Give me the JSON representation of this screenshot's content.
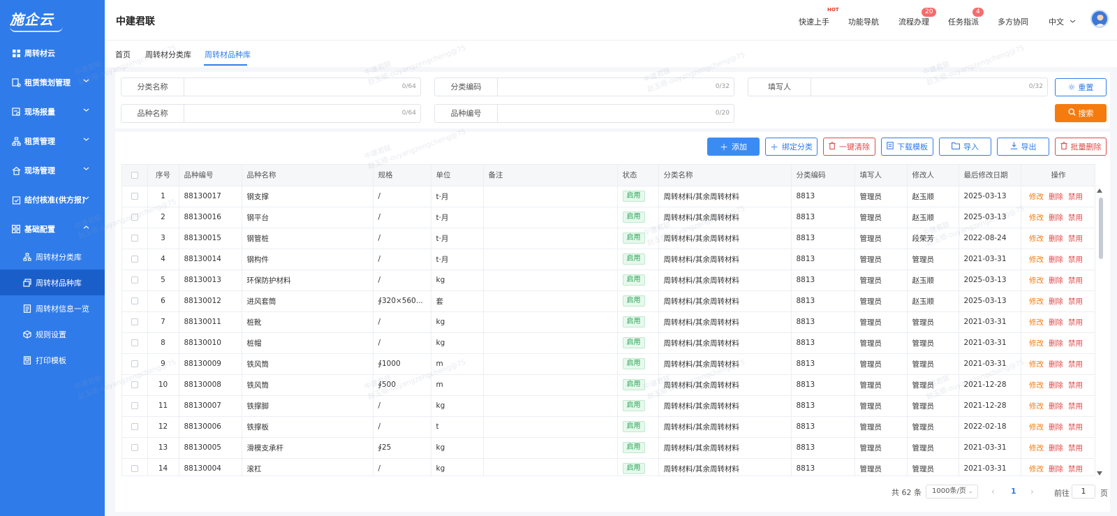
{
  "sidebar": {
    "logo": "施企云",
    "items": [
      {
        "label": "周转材云"
      },
      {
        "label": "租赁策划管理"
      },
      {
        "label": "现场报量"
      },
      {
        "label": "租赁管理"
      },
      {
        "label": "现场管理"
      },
      {
        "label": "结付核准(供方报)"
      },
      {
        "label": "基础配置"
      }
    ],
    "sub_items": [
      {
        "label": "周转材分类库"
      },
      {
        "label": "周转材品种库"
      },
      {
        "label": "周转材信息一览"
      },
      {
        "label": "规则设置"
      },
      {
        "label": "打印模板"
      }
    ]
  },
  "header": {
    "company": "中建君联",
    "nav": {
      "quick_start": "快速上手",
      "hot": "HOT",
      "function_nav": "功能导航",
      "process": "流程办理",
      "process_badge": "20",
      "tasks": "任务指派",
      "tasks_badge": "4",
      "collab": "多方协同",
      "language": "中文"
    }
  },
  "tabs": [
    {
      "label": "首页"
    },
    {
      "label": "周转材分类库"
    },
    {
      "label": "周转材品种库"
    }
  ],
  "filters": {
    "category_name": {
      "label": "分类名称",
      "count": "0/64"
    },
    "category_code": {
      "label": "分类编码",
      "count": "0/32"
    },
    "author": {
      "label": "填写人",
      "count": "0/32"
    },
    "variety_name": {
      "label": "品种名称",
      "count": "0/64"
    },
    "variety_no": {
      "label": "品种编号",
      "count": "0/20"
    },
    "reset_label": "重置",
    "search_label": "搜索"
  },
  "toolbar": {
    "add": "添加",
    "bind_category": "绑定分类",
    "clear_all": "一键清除",
    "download_template": "下载模板",
    "import": "导入",
    "export": "导出",
    "batch_delete": "批量删除"
  },
  "table": {
    "columns": [
      "序号",
      "品种编号",
      "品种名称",
      "规格",
      "单位",
      "备注",
      "状态",
      "分类名称",
      "分类编码",
      "填写人",
      "修改人",
      "最后修改日期",
      "操作"
    ],
    "actions": {
      "edit": "修改",
      "delete": "删除",
      "disable": "禁用"
    },
    "rows": [
      {
        "no": "1",
        "code": "88130017",
        "name": "钢支撑",
        "spec": "/",
        "unit": "t·月",
        "remark": "",
        "status": "启用",
        "category": "周转材料/其余周转材料",
        "cat_code": "8813",
        "author": "管理员",
        "modifier": "赵玉顺",
        "date": "2025-03-13"
      },
      {
        "no": "2",
        "code": "88130016",
        "name": "钢平台",
        "spec": "/",
        "unit": "t·月",
        "remark": "",
        "status": "启用",
        "category": "周转材料/其余周转材料",
        "cat_code": "8813",
        "author": "管理员",
        "modifier": "赵玉顺",
        "date": "2025-03-13"
      },
      {
        "no": "3",
        "code": "88130015",
        "name": "钢管桩",
        "spec": "/",
        "unit": "t·月",
        "remark": "",
        "status": "启用",
        "category": "周转材料/其余周转材料",
        "cat_code": "8813",
        "author": "管理员",
        "modifier": "段荣芳",
        "date": "2022-08-24"
      },
      {
        "no": "4",
        "code": "88130014",
        "name": "钢构件",
        "spec": "/",
        "unit": "t·月",
        "remark": "",
        "status": "启用",
        "category": "周转材料/其余周转材料",
        "cat_code": "8813",
        "author": "管理员",
        "modifier": "管理员",
        "date": "2021-03-31"
      },
      {
        "no": "5",
        "code": "88130013",
        "name": "环保防护材料",
        "spec": "/",
        "unit": "kg",
        "remark": "",
        "status": "启用",
        "category": "周转材料/其余周转材料",
        "cat_code": "8813",
        "author": "管理员",
        "modifier": "赵玉顺",
        "date": "2025-03-13"
      },
      {
        "no": "6",
        "code": "88130012",
        "name": "进风套筒",
        "spec": "∮320×560...",
        "unit": "套",
        "remark": "",
        "status": "启用",
        "category": "周转材料/其余周转材料",
        "cat_code": "8813",
        "author": "管理员",
        "modifier": "赵玉顺",
        "date": "2025-03-13"
      },
      {
        "no": "7",
        "code": "88130011",
        "name": "桩靴",
        "spec": "/",
        "unit": "kg",
        "remark": "",
        "status": "启用",
        "category": "周转材料/其余周转材料",
        "cat_code": "8813",
        "author": "管理员",
        "modifier": "管理员",
        "date": "2021-03-31"
      },
      {
        "no": "8",
        "code": "88130010",
        "name": "桩帽",
        "spec": "/",
        "unit": "kg",
        "remark": "",
        "status": "启用",
        "category": "周转材料/其余周转材料",
        "cat_code": "8813",
        "author": "管理员",
        "modifier": "管理员",
        "date": "2021-03-31"
      },
      {
        "no": "9",
        "code": "88130009",
        "name": "铁风筒",
        "spec": "∮1000",
        "unit": "m",
        "remark": "",
        "status": "启用",
        "category": "周转材料/其余周转材料",
        "cat_code": "8813",
        "author": "管理员",
        "modifier": "管理员",
        "date": "2021-03-31"
      },
      {
        "no": "10",
        "code": "88130008",
        "name": "铁风筒",
        "spec": "∮500",
        "unit": "m",
        "remark": "",
        "status": "启用",
        "category": "周转材料/其余周转材料",
        "cat_code": "8813",
        "author": "管理员",
        "modifier": "管理员",
        "date": "2021-12-28"
      },
      {
        "no": "11",
        "code": "88130007",
        "name": "铁撑脚",
        "spec": "/",
        "unit": "kg",
        "remark": "",
        "status": "启用",
        "category": "周转材料/其余周转材料",
        "cat_code": "8813",
        "author": "管理员",
        "modifier": "管理员",
        "date": "2021-12-28"
      },
      {
        "no": "12",
        "code": "88130006",
        "name": "铁撑板",
        "spec": "/",
        "unit": "t",
        "remark": "",
        "status": "启用",
        "category": "周转材料/其余周转材料",
        "cat_code": "8813",
        "author": "管理员",
        "modifier": "管理员",
        "date": "2022-02-18"
      },
      {
        "no": "13",
        "code": "88130005",
        "name": "滑模支承杆",
        "spec": "∮25",
        "unit": "kg",
        "remark": "",
        "status": "启用",
        "category": "周转材料/其余周转材料",
        "cat_code": "8813",
        "author": "管理员",
        "modifier": "管理员",
        "date": "2021-03-31"
      },
      {
        "no": "14",
        "code": "88130004",
        "name": "滚杠",
        "spec": "/",
        "unit": "kg",
        "remark": "",
        "status": "启用",
        "category": "周转材料/其余周转材料",
        "cat_code": "8813",
        "author": "管理员",
        "modifier": "管理员",
        "date": "2021-03-31"
      }
    ]
  },
  "pagination": {
    "total": "共 62 条",
    "page_size": "1000条/页",
    "current_page": "1",
    "goto_label": "前往",
    "goto_value": "1",
    "unit": "页"
  },
  "watermark": {
    "line1": "中建君联",
    "line2": "赵玉顺-ouyangzengcheng@75"
  },
  "colors": {
    "primary": "#2f7bea",
    "orange": "#f57b0e",
    "danger": "#e04848",
    "success": "#2ca35a"
  }
}
